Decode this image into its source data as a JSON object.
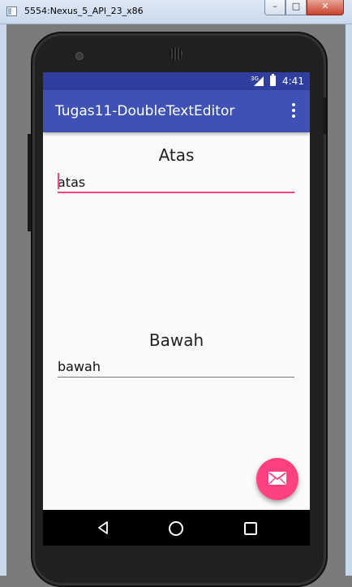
{
  "window": {
    "title": "5554:Nexus_5_API_23_x86",
    "minimize_glyph": "–",
    "maximize_glyph": "□",
    "close_glyph": "✕"
  },
  "statusbar": {
    "network": "3G",
    "time": "4:41"
  },
  "appbar": {
    "title": "Tugas11-DoubleTextEditor",
    "menu_icon": "overflow-menu-icon"
  },
  "top_section": {
    "label": "Atas",
    "input_value": "atas"
  },
  "bottom_section": {
    "label": "Bawah",
    "input_value": "bawah"
  },
  "fab": {
    "icon": "mail-icon",
    "color": "#ff4081"
  },
  "navbar": {
    "buttons": [
      "back-icon",
      "home-icon",
      "recent-apps-icon"
    ]
  },
  "colors": {
    "primary": "#3f51b5",
    "primary_dark": "#303f9f",
    "accent": "#ff4081"
  }
}
